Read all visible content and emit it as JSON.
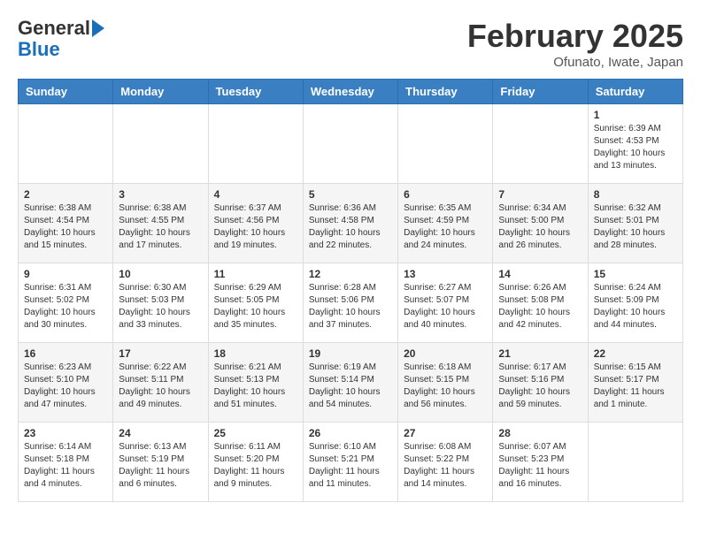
{
  "header": {
    "logo_general": "General",
    "logo_blue": "Blue",
    "month_title": "February 2025",
    "subtitle": "Ofunato, Iwate, Japan"
  },
  "weekdays": [
    "Sunday",
    "Monday",
    "Tuesday",
    "Wednesday",
    "Thursday",
    "Friday",
    "Saturday"
  ],
  "weeks": [
    [
      {
        "day": "",
        "info": ""
      },
      {
        "day": "",
        "info": ""
      },
      {
        "day": "",
        "info": ""
      },
      {
        "day": "",
        "info": ""
      },
      {
        "day": "",
        "info": ""
      },
      {
        "day": "",
        "info": ""
      },
      {
        "day": "1",
        "info": "Sunrise: 6:39 AM\nSunset: 4:53 PM\nDaylight: 10 hours and 13 minutes."
      }
    ],
    [
      {
        "day": "2",
        "info": "Sunrise: 6:38 AM\nSunset: 4:54 PM\nDaylight: 10 hours and 15 minutes."
      },
      {
        "day": "3",
        "info": "Sunrise: 6:38 AM\nSunset: 4:55 PM\nDaylight: 10 hours and 17 minutes."
      },
      {
        "day": "4",
        "info": "Sunrise: 6:37 AM\nSunset: 4:56 PM\nDaylight: 10 hours and 19 minutes."
      },
      {
        "day": "5",
        "info": "Sunrise: 6:36 AM\nSunset: 4:58 PM\nDaylight: 10 hours and 22 minutes."
      },
      {
        "day": "6",
        "info": "Sunrise: 6:35 AM\nSunset: 4:59 PM\nDaylight: 10 hours and 24 minutes."
      },
      {
        "day": "7",
        "info": "Sunrise: 6:34 AM\nSunset: 5:00 PM\nDaylight: 10 hours and 26 minutes."
      },
      {
        "day": "8",
        "info": "Sunrise: 6:32 AM\nSunset: 5:01 PM\nDaylight: 10 hours and 28 minutes."
      }
    ],
    [
      {
        "day": "9",
        "info": "Sunrise: 6:31 AM\nSunset: 5:02 PM\nDaylight: 10 hours and 30 minutes."
      },
      {
        "day": "10",
        "info": "Sunrise: 6:30 AM\nSunset: 5:03 PM\nDaylight: 10 hours and 33 minutes."
      },
      {
        "day": "11",
        "info": "Sunrise: 6:29 AM\nSunset: 5:05 PM\nDaylight: 10 hours and 35 minutes."
      },
      {
        "day": "12",
        "info": "Sunrise: 6:28 AM\nSunset: 5:06 PM\nDaylight: 10 hours and 37 minutes."
      },
      {
        "day": "13",
        "info": "Sunrise: 6:27 AM\nSunset: 5:07 PM\nDaylight: 10 hours and 40 minutes."
      },
      {
        "day": "14",
        "info": "Sunrise: 6:26 AM\nSunset: 5:08 PM\nDaylight: 10 hours and 42 minutes."
      },
      {
        "day": "15",
        "info": "Sunrise: 6:24 AM\nSunset: 5:09 PM\nDaylight: 10 hours and 44 minutes."
      }
    ],
    [
      {
        "day": "16",
        "info": "Sunrise: 6:23 AM\nSunset: 5:10 PM\nDaylight: 10 hours and 47 minutes."
      },
      {
        "day": "17",
        "info": "Sunrise: 6:22 AM\nSunset: 5:11 PM\nDaylight: 10 hours and 49 minutes."
      },
      {
        "day": "18",
        "info": "Sunrise: 6:21 AM\nSunset: 5:13 PM\nDaylight: 10 hours and 51 minutes."
      },
      {
        "day": "19",
        "info": "Sunrise: 6:19 AM\nSunset: 5:14 PM\nDaylight: 10 hours and 54 minutes."
      },
      {
        "day": "20",
        "info": "Sunrise: 6:18 AM\nSunset: 5:15 PM\nDaylight: 10 hours and 56 minutes."
      },
      {
        "day": "21",
        "info": "Sunrise: 6:17 AM\nSunset: 5:16 PM\nDaylight: 10 hours and 59 minutes."
      },
      {
        "day": "22",
        "info": "Sunrise: 6:15 AM\nSunset: 5:17 PM\nDaylight: 11 hours and 1 minute."
      }
    ],
    [
      {
        "day": "23",
        "info": "Sunrise: 6:14 AM\nSunset: 5:18 PM\nDaylight: 11 hours and 4 minutes."
      },
      {
        "day": "24",
        "info": "Sunrise: 6:13 AM\nSunset: 5:19 PM\nDaylight: 11 hours and 6 minutes."
      },
      {
        "day": "25",
        "info": "Sunrise: 6:11 AM\nSunset: 5:20 PM\nDaylight: 11 hours and 9 minutes."
      },
      {
        "day": "26",
        "info": "Sunrise: 6:10 AM\nSunset: 5:21 PM\nDaylight: 11 hours and 11 minutes."
      },
      {
        "day": "27",
        "info": "Sunrise: 6:08 AM\nSunset: 5:22 PM\nDaylight: 11 hours and 14 minutes."
      },
      {
        "day": "28",
        "info": "Sunrise: 6:07 AM\nSunset: 5:23 PM\nDaylight: 11 hours and 16 minutes."
      },
      {
        "day": "",
        "info": ""
      }
    ]
  ]
}
